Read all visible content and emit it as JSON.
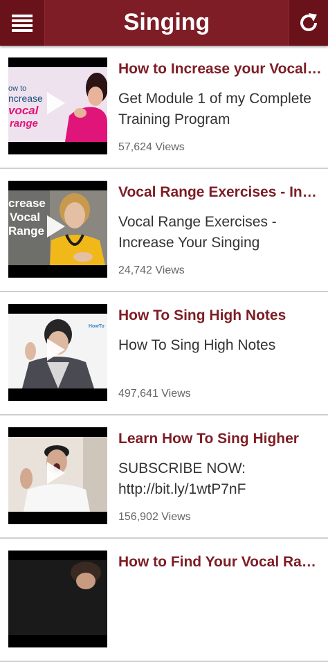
{
  "header": {
    "title": "Singing",
    "menu_icon": "hamburger-menu-icon",
    "refresh_icon": "refresh-icon"
  },
  "colors": {
    "brand": "#7e1d25",
    "brand_dark": "#6a1219",
    "title_text": "#7e1d25"
  },
  "videos": [
    {
      "title": "How to Increase your Vocal Range",
      "description": "Get Module 1 of my Complete Training Program",
      "views": "57,624 Views",
      "thumb_text": [
        "ow to",
        "ncrease",
        "vocal",
        "range"
      ]
    },
    {
      "title": "Vocal Range Exercises - Increase Your Singing",
      "description": "Vocal Range Exercises - Increase Your Singing",
      "views": "24,742 Views",
      "thumb_text": [
        "crease",
        "Vocal",
        "Range"
      ]
    },
    {
      "title": "How To Sing High Notes",
      "description": "How To Sing High Notes",
      "views": "497,641 Views",
      "thumb_text": [
        "HowTo"
      ]
    },
    {
      "title": "Learn How To Sing Higher",
      "description": "SUBSCRIBE NOW: http://bit.ly/1wtP7nF",
      "views": "156,902 Views",
      "thumb_text": []
    },
    {
      "title": "How to Find Your Vocal Range",
      "description": "",
      "views": "",
      "thumb_text": []
    }
  ]
}
